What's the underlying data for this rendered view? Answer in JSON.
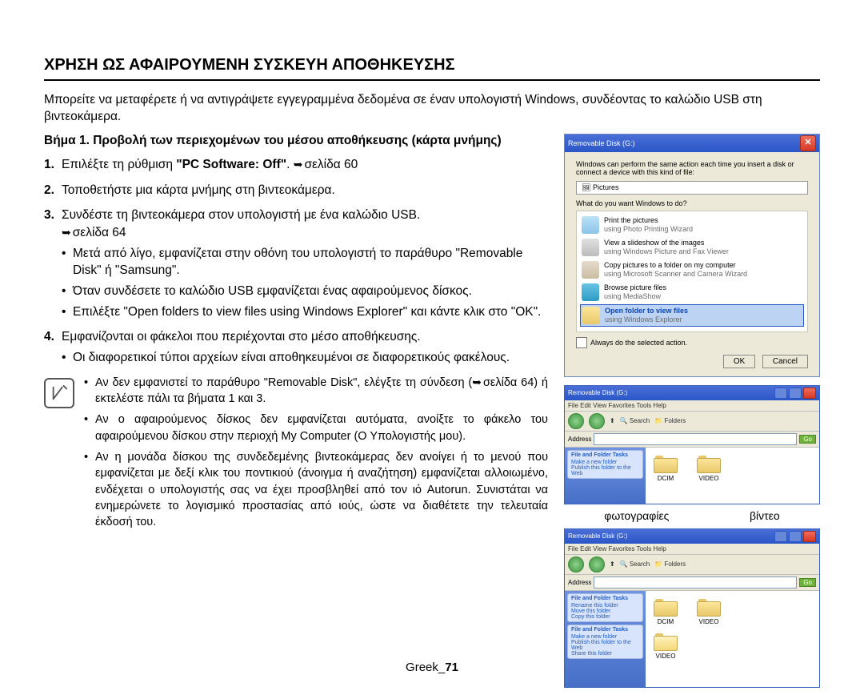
{
  "heading": "ΧΡΗΣΗ ΩΣ ΑΦΑΙΡΟΥΜΕΝΗ ΣΥΣΚΕΥΗ ΑΠΟΘΗΚΕΥΣΗΣ",
  "intro": "Μπορείτε να μεταφέρετε ή να αντιγράψετε εγγεγραμμένα δεδομένα σε έναν υπολογιστή Windows, συνδέοντας το καλώδιο USB στη βιντεοκάμερα.",
  "step_title": "Βήμα 1. Προβολή των περιεχομένων του μέσου αποθήκευσης (κάρτα μνήμης)",
  "list": {
    "n1": "1.",
    "i1a": "Επιλέξτε τη ρύθμιση ",
    "i1b": "\"PC Software: Off\"",
    "i1c": ". ",
    "i1d": "σελίδα 60",
    "n2": "2.",
    "i2": "Τοποθετήστε μια κάρτα μνήμης στη βιντεοκάμερα.",
    "n3": "3.",
    "i3a": "Συνδέστε τη βιντεοκάμερα στον υπολογιστή με ένα καλώδιο USB.",
    "i3b": "σελίδα 64",
    "i3_b1": "Μετά από λίγο, εμφανίζεται στην οθόνη του υπολογιστή το παράθυρο \"Removable Disk\" ή \"Samsung\".",
    "i3_b2": "Όταν συνδέσετε το καλώδιο USB εμφανίζεται ένας αφαιρούμενος δίσκος.",
    "i3_b3": "Επιλέξτε \"Open folders to view files using Windows Explorer\" και κάντε κλικ στο \"OK\".",
    "n4": "4.",
    "i4a": "Εμφανίζονται οι φάκελοι που περιέχονται στο μέσο αποθήκευσης.",
    "i4_b1": "Οι διαφορετικοί τύποι αρχείων είναι αποθηκευμένοι σε διαφορετικούς φακέλους."
  },
  "notes": {
    "n1a": "Αν δεν εμφανιστεί το παράθυρο \"Removable Disk\", ελέγξτε τη σύνδεση (",
    "n1b": "σελίδα 64) ή εκτελέστε πάλι τα βήματα 1 και 3.",
    "n2": "Αν ο αφαιρούμενος δίσκος δεν εμφανίζεται αυτόματα, ανοίξτε το φάκελο του αφαιρούμενου δίσκου στην περιοχή My Computer (Ο Υπολογιστής μου).",
    "n3": "Αν η μονάδα δίσκου της συνδεδεμένης βιντεοκάμερας δεν ανοίγει ή το μενού που εμφανίζεται με δεξί κλικ του ποντικιού (άνοιγμα ή αναζήτηση) εμφανίζεται αλλοιωμένο, ενδέχεται ο υπολογιστής σας να έχει προσβληθεί από τον ιό Autorun. Συνιστάται να ενημερώνετε το λογισμικό προστασίας από ιούς, ώστε να διαθέτετε την τελευταία έκδοσή του."
  },
  "dialog": {
    "title": "Removable Disk (G:)",
    "msg": "Windows can perform the same action each time you insert a disk or connect a device with this kind of file:",
    "pictures": "Pictures",
    "question": "What do you want Windows to do?",
    "opts": [
      {
        "l1": "Print the pictures",
        "l2": "using Photo Printing Wizard"
      },
      {
        "l1": "View a slideshow of the images",
        "l2": "using Windows Picture and Fax Viewer"
      },
      {
        "l1": "Copy pictures to a folder on my computer",
        "l2": "using Microsoft Scanner and Camera Wizard"
      },
      {
        "l1": "Browse picture files",
        "l2": "using MediaShow"
      },
      {
        "l1": "Open folder to view files",
        "l2": "using Windows Explorer"
      }
    ],
    "always": "Always do the selected action.",
    "ok": "OK",
    "cancel": "Cancel"
  },
  "exp1": {
    "title": "Removable Disk (G:)",
    "menu": "File  Edit  View  Favorites  Tools  Help",
    "search": "Search",
    "folders_btn": "Folders",
    "addr": "Address",
    "go": "Go",
    "task_head": "File and Folder Tasks",
    "t1": "Make a new folder",
    "t2": "Publish this folder to the Web",
    "f1": "DCIM",
    "f2": "VIDEO"
  },
  "labels": {
    "photos": "φωτογραφίες",
    "videos": "βίντεο"
  },
  "exp2": {
    "title": "Removable Disk (G:)",
    "task1_head": "File and Folder Tasks",
    "t1a": "Rename this folder",
    "t1b": "Move this folder",
    "t1c": "Copy this folder",
    "task2_head": "File and Folder Tasks",
    "t2a": "Make a new folder",
    "t2b": "Publish this folder to the Web",
    "t2c": "Share this folder",
    "f1": "DCIM",
    "f2": "VIDEO",
    "f3": "VIDEO"
  },
  "footer": {
    "lang": "Greek",
    "sep": "_",
    "page": "71"
  }
}
